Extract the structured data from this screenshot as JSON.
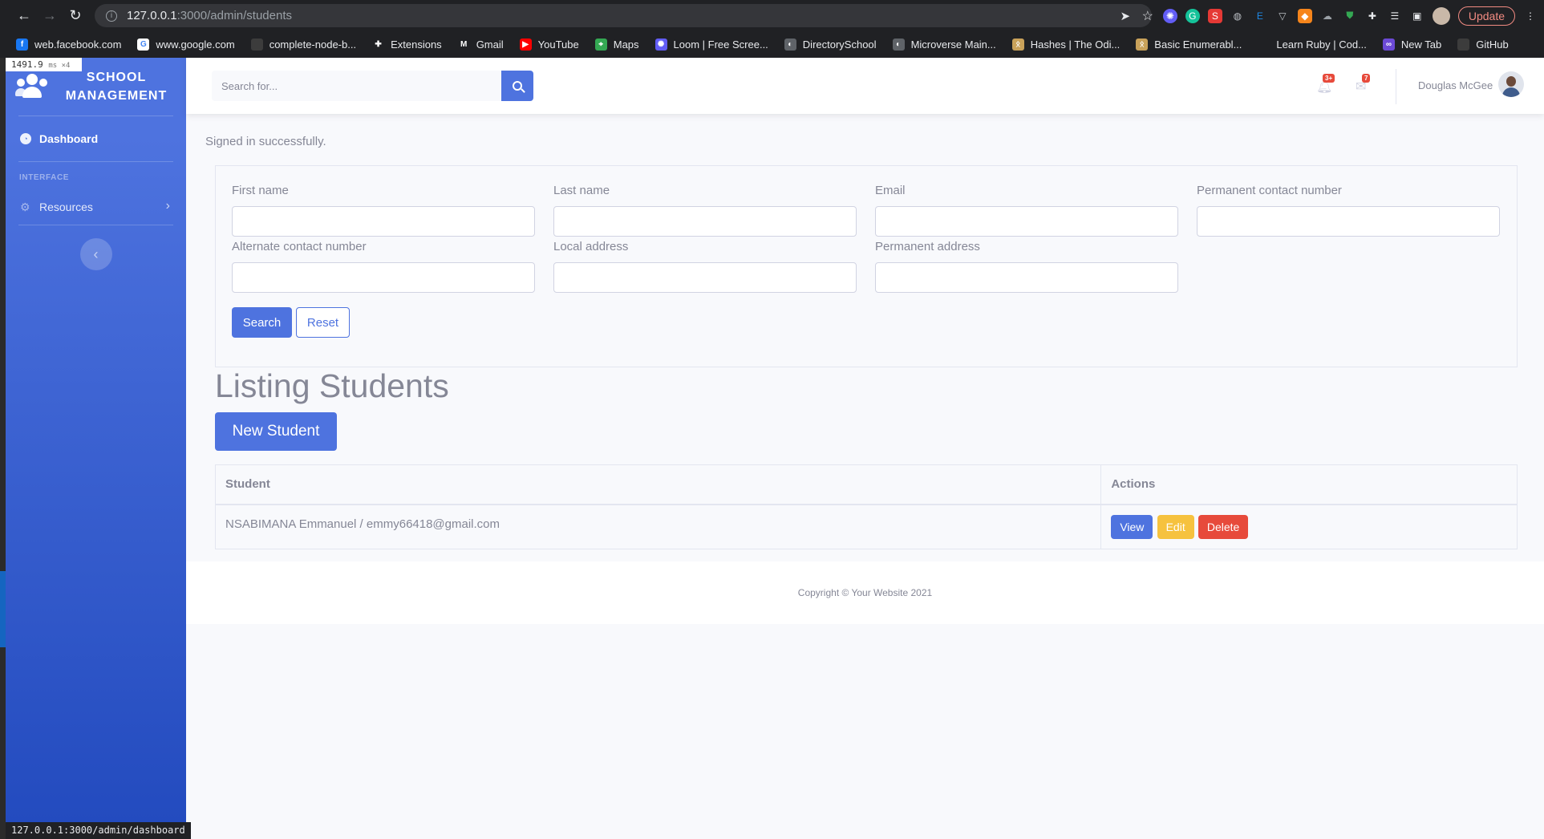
{
  "browser": {
    "url_host": "127.0.0.1",
    "url_rest": ":3000/admin/students",
    "update_label": "Update",
    "bookmarks": [
      {
        "label": "web.facebook.com",
        "icon": "facebook-icon",
        "color": "#1877f2",
        "glyph": "f"
      },
      {
        "label": "www.google.com",
        "icon": "google-icon",
        "color": "#ffffff",
        "glyph": "G"
      },
      {
        "label": "complete-node-b...",
        "icon": "github-icon",
        "color": "#3c3c3c",
        "glyph": ""
      },
      {
        "label": "Extensions",
        "icon": "puzzle-icon",
        "color": "#202124",
        "glyph": "✚"
      },
      {
        "label": "Gmail",
        "icon": "gmail-icon",
        "color": "#202124",
        "glyph": "M"
      },
      {
        "label": "YouTube",
        "icon": "youtube-icon",
        "color": "#ff0000",
        "glyph": "▶"
      },
      {
        "label": "Maps",
        "icon": "maps-icon",
        "color": "#34a853",
        "glyph": "⌖"
      },
      {
        "label": "Loom | Free Scree...",
        "icon": "loom-icon",
        "color": "#625df5",
        "glyph": "✺"
      },
      {
        "label": "DirectorySchool",
        "icon": "globe-icon",
        "color": "#5f6368",
        "glyph": "◐"
      },
      {
        "label": "Microverse Main...",
        "icon": "globe-icon",
        "color": "#5f6368",
        "glyph": "◐"
      },
      {
        "label": "Hashes | The Odi...",
        "icon": "odin-icon",
        "color": "#c9a25a",
        "glyph": "ᛟ"
      },
      {
        "label": "Basic Enumerabl...",
        "icon": "odin-icon",
        "color": "#c9a25a",
        "glyph": "ᛟ"
      },
      {
        "label": "Learn Ruby | Cod...",
        "icon": "codecademy-icon",
        "color": "#202124",
        "glyph": ""
      },
      {
        "label": "New Tab",
        "icon": "newtab-icon",
        "color": "#6c4ad6",
        "glyph": "∞"
      },
      {
        "label": "GitHub",
        "icon": "github-icon",
        "color": "#3c3c3c",
        "glyph": ""
      }
    ]
  },
  "debug": {
    "timing_value": "1491.9",
    "timing_unit": "ms ×4",
    "status_url": "127.0.0.1:3000/admin/dashboard"
  },
  "sidebar": {
    "brand_title": "SCHOOL MANAGEMENT",
    "dashboard_label": "Dashboard",
    "heading": "INTERFACE",
    "resources_label": "Resources"
  },
  "topbar": {
    "search_placeholder": "Search for...",
    "alerts_count": "3+",
    "messages_count": "7",
    "user_name": "Douglas McGee"
  },
  "main": {
    "flash": "Signed in successfully.",
    "filters": {
      "first_name_label": "First name",
      "last_name_label": "Last name",
      "email_label": "Email",
      "permanent_contact_label": "Permanent contact number",
      "alternate_contact_label": "Alternate contact number",
      "local_address_label": "Local address",
      "permanent_address_label": "Permanent address",
      "search_label": "Search",
      "reset_label": "Reset"
    },
    "listing_title": "Listing Students",
    "new_student_label": "New Student",
    "table": {
      "headers": [
        "Student",
        "Actions"
      ],
      "rows": [
        {
          "student": "NSABIMANA Emmanuel / emmy66418@gmail.com",
          "view": "View",
          "edit": "Edit",
          "delete": "Delete"
        }
      ]
    },
    "footer": "Copyright © Your Website 2021"
  },
  "colors": {
    "primary": "#4e73df",
    "warning": "#f6c23e",
    "danger": "#e74a3b"
  }
}
